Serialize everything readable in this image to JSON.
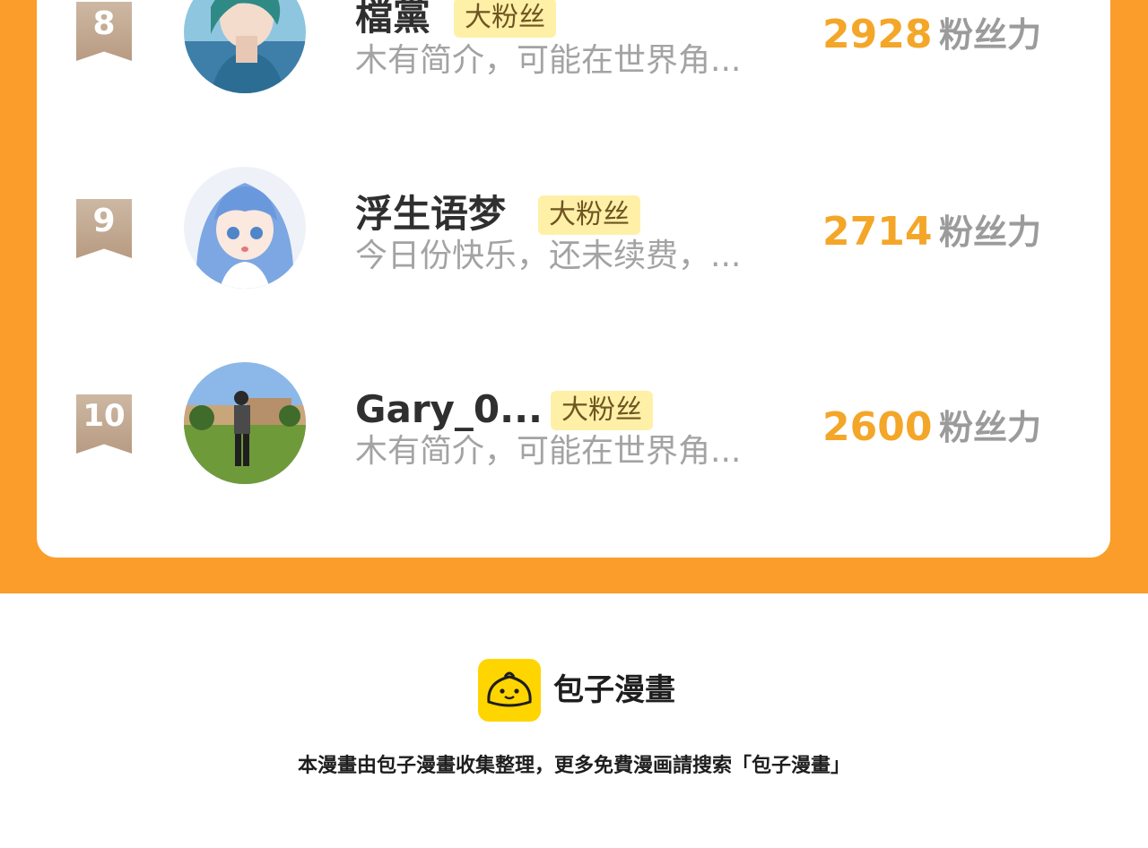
{
  "ranking": {
    "rows": [
      {
        "rank": "8",
        "name": "檔黨",
        "badge": "大粉丝",
        "bio": "木有简介，可能在世界角...",
        "score": "2928",
        "score_unit": "粉丝力",
        "avatar_icon": "anime-boy-avatar-icon"
      },
      {
        "rank": "9",
        "name": "浮生语梦",
        "badge": "大粉丝",
        "bio": "今日份快乐，还未续费，...",
        "score": "2714",
        "score_unit": "粉丝力",
        "avatar_icon": "anime-girl-avatar-icon"
      },
      {
        "rank": "10",
        "name": "Gary_0...",
        "badge": "大粉丝",
        "bio": "木有简介，可能在世界角...",
        "score": "2600",
        "score_unit": "粉丝力",
        "avatar_icon": "photo-person-avatar-icon"
      }
    ]
  },
  "footer": {
    "brand_name": "包子漫畫",
    "note": "本漫畫由包子漫畫收集整理，更多免費漫画請搜索「包子漫畫」"
  },
  "colors": {
    "orange_band": "#fb9d2b",
    "score": "#f4a629",
    "badge_bg": "#fff0a8",
    "logo_bg": "#ffd500"
  }
}
